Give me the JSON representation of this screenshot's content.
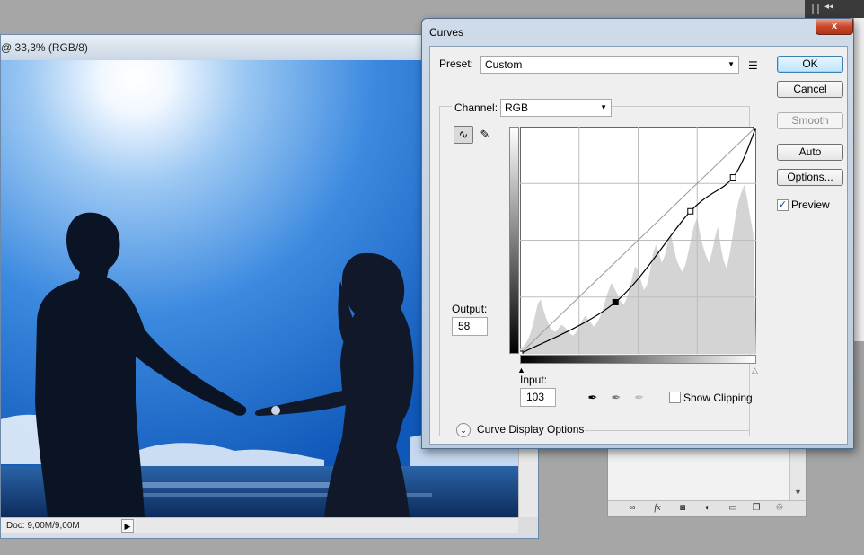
{
  "document": {
    "title": "@ 33,3% (RGB/8)",
    "status": "Doc: 9,00M/9,00M",
    "status_arrow": "▶"
  },
  "panel": {
    "collapse_glyph": "◂◂"
  },
  "layers_footer": {
    "icons": [
      "link-icon",
      "fx-icon",
      "mask-icon",
      "adjustment-icon",
      "folder-icon",
      "new-layer-icon",
      "trash-icon"
    ],
    "fx_label": "fx"
  },
  "curves": {
    "title": "Curves",
    "close_glyph": "x",
    "preset_label": "Preset:",
    "preset_value": "Custom",
    "channel_label": "Channel:",
    "channel_value": "RGB",
    "buttons": {
      "ok": "OK",
      "cancel": "Cancel",
      "smooth": "Smooth",
      "auto": "Auto",
      "options": "Options..."
    },
    "preview_label": "Preview",
    "preview_checked": true,
    "output_label": "Output:",
    "output_value": "58",
    "input_label": "Input:",
    "input_value": "103",
    "show_clipping_label": "Show Clipping",
    "show_clipping_checked": false,
    "display_options_label": "Curve Display Options",
    "curve_points": [
      [
        0,
        0
      ],
      [
        103,
        58
      ],
      [
        184,
        160
      ],
      [
        230,
        198
      ],
      [
        255,
        255
      ]
    ],
    "selected_point_index": 1,
    "histogram": [
      5,
      8,
      12,
      18,
      28,
      40,
      55,
      60,
      48,
      38,
      30,
      26,
      24,
      28,
      32,
      30,
      26,
      22,
      20,
      24,
      30,
      36,
      42,
      38,
      34,
      30,
      34,
      40,
      48,
      60,
      70,
      78,
      72,
      66,
      58,
      54,
      60,
      70,
      84,
      96,
      92,
      80,
      70,
      76,
      90,
      110,
      120,
      112,
      100,
      108,
      122,
      132,
      118,
      104,
      96,
      90,
      98,
      112,
      128,
      142,
      150,
      132,
      118,
      108,
      100,
      112,
      128,
      140,
      118,
      102,
      94,
      110,
      130,
      152,
      168,
      178,
      186,
      170,
      150,
      132
    ]
  },
  "colors": {
    "dialog_border": "#4f6d8f",
    "close_red": "#c9472a",
    "ok_blue": "#3c7fb1"
  }
}
